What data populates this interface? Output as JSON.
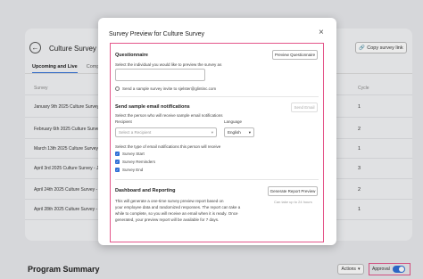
{
  "background": {
    "page_title": "Culture Survey - Je",
    "back_icon": "arrow-left-icon",
    "copy_link_label": "Copy survey link",
    "tabs": [
      {
        "label": "Upcoming and Live",
        "active": true
      },
      {
        "label": "Completed",
        "active": false
      }
    ],
    "columns": {
      "survey": "Survey",
      "cycle": "Cycle"
    },
    "rows": [
      {
        "survey": "January 9th 2025 Culture Survey -",
        "cycle": "1"
      },
      {
        "survey": "February 6th 2025 Culture Survey -",
        "cycle": "2"
      },
      {
        "survey": "March 13th 2025 Culture Survey -",
        "cycle": "1"
      },
      {
        "survey": "April 3rd 2025 Culture Survey - Je",
        "cycle": "3"
      },
      {
        "survey": "April 24th 2025 Culture Survey - Je",
        "cycle": "2"
      },
      {
        "survey": "April 28th 2025 Culture Survey - Je",
        "cycle": "1"
      }
    ],
    "program_summary": "Program Summary",
    "actions_label": "Actions",
    "approval_label": "Approval",
    "approval_on": true
  },
  "modal": {
    "title": "Survey Preview for Culture Survey",
    "questionnaire": {
      "heading": "Questionnaire",
      "preview_button": "Preview Questionnaire",
      "instruction": "Select the individual you would like to preview the survey as",
      "input_value": "",
      "sample_invite_label": "Send a sample survey invite to sjelster@glintinc.com"
    },
    "notifications": {
      "heading": "Send sample email notifications",
      "send_button": "Send Email",
      "instruction": "Select the person who will receive sample email notifications",
      "recipient_label": "Recipient",
      "recipient_placeholder": "Select a Recipient",
      "language_label": "Language",
      "language_value": "English",
      "types_instruction": "Select the type of email notifications this person will receive",
      "types": [
        {
          "label": "Survey Start",
          "checked": true
        },
        {
          "label": "Survey Reminders",
          "checked": true
        },
        {
          "label": "Survey End",
          "checked": true
        }
      ]
    },
    "reporting": {
      "heading": "Dashboard and Reporting",
      "generate_button": "Generate Report Preview",
      "note": "Can take up to 24 hours",
      "description_lines": [
        "This will generate a one-time survey preview report based on",
        "your employee data and randomized responses. The report can take a",
        "while to complete, so you will receive an email when it is ready. Once",
        "generated, your preview report will be available for 7 days."
      ]
    }
  }
}
